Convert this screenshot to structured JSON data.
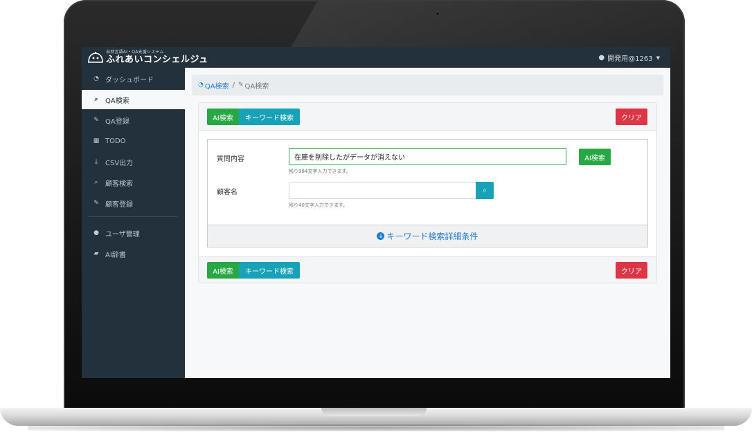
{
  "app": {
    "tagline": "自然言語AI・QA支援システム",
    "name": "ふれあいコンシェルジュ",
    "user": "開発用@1263"
  },
  "sidebar": {
    "items": [
      {
        "label": "ダッシュボード",
        "icon": "dashboard-icon",
        "glyph": "◔"
      },
      {
        "label": "QA検索",
        "icon": "search-icon",
        "glyph": "⌕"
      },
      {
        "label": "QA登録",
        "icon": "edit-icon",
        "glyph": "✎"
      },
      {
        "label": "TODO",
        "icon": "calendar-icon",
        "glyph": "▦"
      },
      {
        "label": "CSV出力",
        "icon": "download-icon",
        "glyph": "⤓"
      },
      {
        "label": "顧客検索",
        "icon": "search-icon",
        "glyph": "⌕"
      },
      {
        "label": "顧客登録",
        "icon": "edit-icon",
        "glyph": "✎"
      },
      {
        "label": "ユーザ管理",
        "icon": "user-icon",
        "glyph": "●"
      },
      {
        "label": "AI辞書",
        "icon": "book-icon",
        "glyph": "▰"
      }
    ],
    "active_index": 1
  },
  "breadcrumb": {
    "home": "QA検索",
    "separator": "/",
    "current": "QA検索"
  },
  "tabs": {
    "ai": "AI検索",
    "keyword": "キーワード検索"
  },
  "actions": {
    "clear": "クリア",
    "ai_search": "AI検索"
  },
  "form": {
    "question_label": "質問内容",
    "question_value": "在庫を削除したがデータが消えない",
    "question_hint": "残り984文字入力できます。",
    "customer_label": "顧客名",
    "customer_value": "",
    "customer_hint": "残り40文字入力できます。"
  },
  "advanced": {
    "label": "キーワード検索詳細条件"
  },
  "colors": {
    "navy": "#23313c",
    "green": "#28a745",
    "teal": "#17a2b8",
    "red": "#dc3545",
    "link": "#1f7ccf"
  }
}
